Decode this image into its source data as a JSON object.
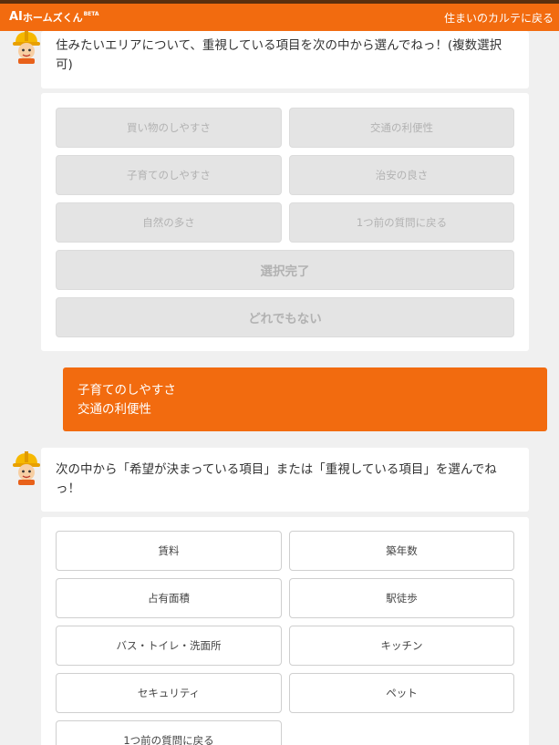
{
  "header": {
    "brand_ai": "AI",
    "brand_name": "ホームズくん",
    "brand_badge": "BETA",
    "back_link": "住まいのカルテに戻る"
  },
  "colors": {
    "accent": "#f26b0f",
    "topline": "#5a2f0e",
    "background": "#f0f0f0"
  },
  "chat": {
    "question1": "住みたいエリアについて、重視している項目を次の中から選んでねっ！(複数選択可)",
    "options1": [
      "買い物のしやすさ",
      "交通の利便性",
      "子育てのしやすさ",
      "治安の良さ",
      "自然の多さ",
      "1つ前の質問に戻る"
    ],
    "complete_label": "選択完了",
    "none_label": "どれでもない",
    "answer": [
      "子育てのしやすさ",
      "交通の利便性"
    ],
    "question2": "次の中から「希望が決まっている項目」または「重視している項目」を選んでねっ！",
    "options2": [
      "賃料",
      "築年数",
      "占有面積",
      "駅徒歩",
      "バス・トイレ・洗面所",
      "キッチン",
      "セキュリティ",
      "ペット",
      "1つ前の質問に戻る"
    ]
  },
  "icons": {
    "avatar": "construction-worker-avatar-icon"
  }
}
